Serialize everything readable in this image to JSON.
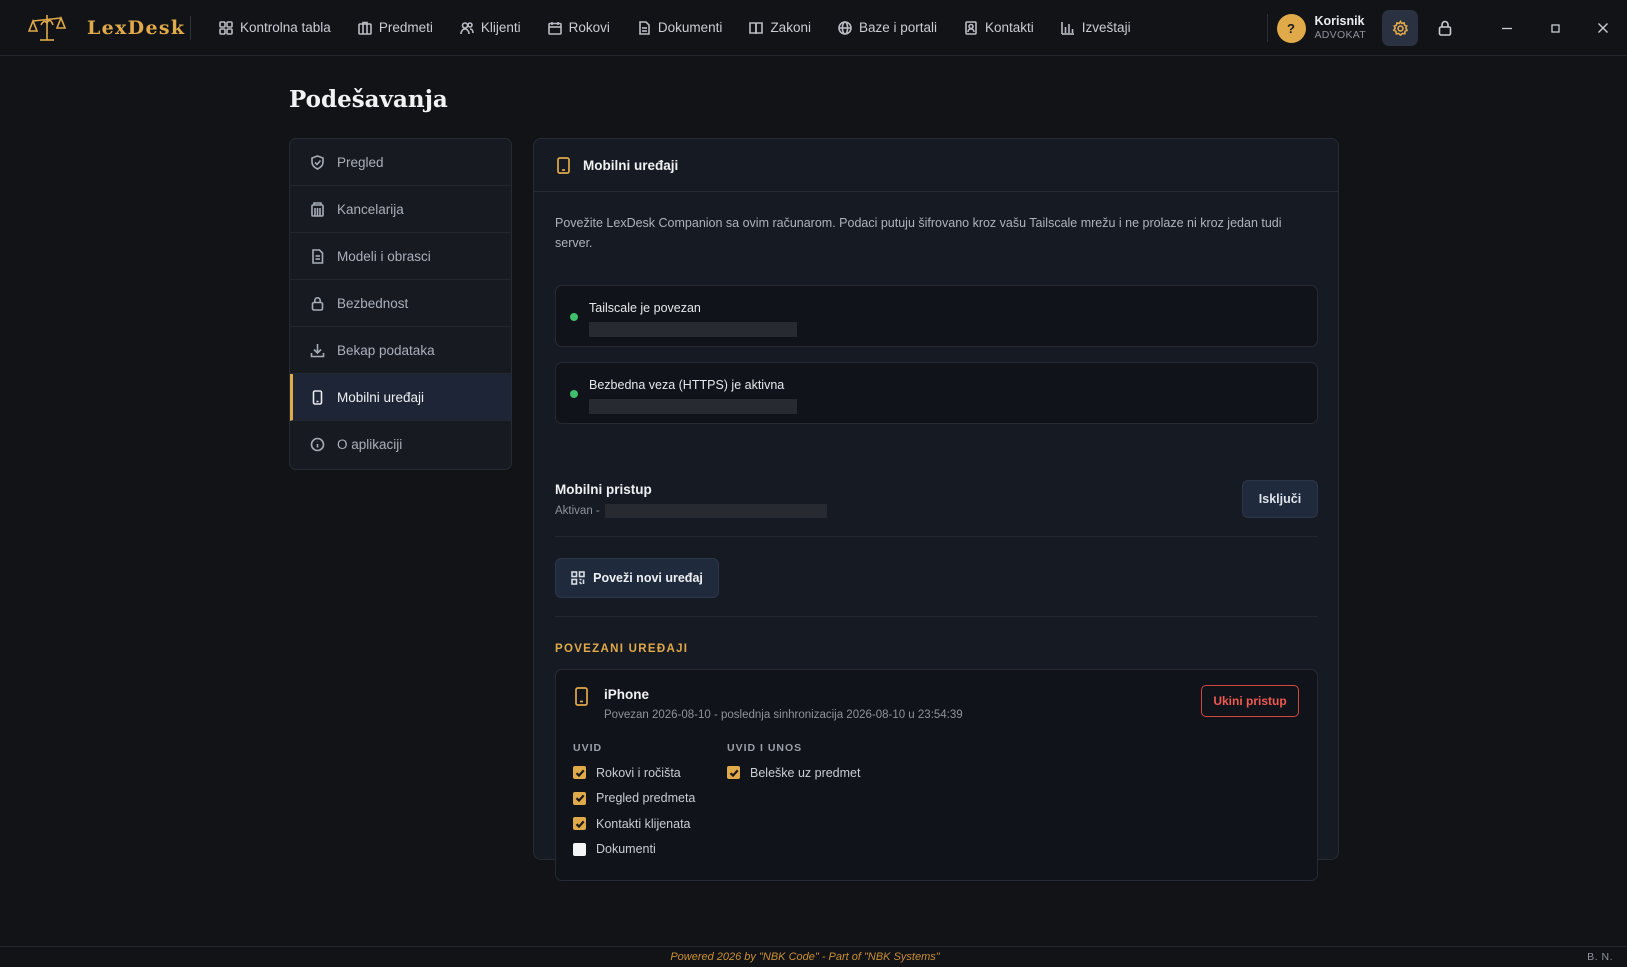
{
  "app": {
    "name": "LexDesk",
    "accent": "#e0a94a"
  },
  "nav": [
    {
      "label": "Kontrolna tabla",
      "icon": "dashboard-icon"
    },
    {
      "label": "Predmeti",
      "icon": "briefcase-icon"
    },
    {
      "label": "Klijenti",
      "icon": "users-icon"
    },
    {
      "label": "Rokovi",
      "icon": "calendar-icon"
    },
    {
      "label": "Dokumenti",
      "icon": "document-icon"
    },
    {
      "label": "Zakoni",
      "icon": "book-icon"
    },
    {
      "label": "Baze i portali",
      "icon": "globe-icon"
    },
    {
      "label": "Kontakti",
      "icon": "contact-icon"
    },
    {
      "label": "Izveštaji",
      "icon": "bar-chart-icon"
    }
  ],
  "user": {
    "avatar_letter": "?",
    "name": "Korisnik",
    "role": "ADVOKAT"
  },
  "page": {
    "title": "Podešavanja"
  },
  "sidebar": {
    "items": [
      {
        "label": "Pregled",
        "icon": "shield-icon"
      },
      {
        "label": "Kancelarija",
        "icon": "building-icon"
      },
      {
        "label": "Modeli i obrasci",
        "icon": "file-icon"
      },
      {
        "label": "Bezbednost",
        "icon": "lock-icon"
      },
      {
        "label": "Bekap podataka",
        "icon": "download-icon"
      },
      {
        "label": "Mobilni uređaji",
        "icon": "phone-icon",
        "active": true
      },
      {
        "label": "O aplikaciji",
        "icon": "info-icon"
      }
    ]
  },
  "card": {
    "title": "Mobilni uređaji",
    "description": "Povežite LexDesk Companion sa ovim računarom. Podaci putuju šifrovano kroz vašu Tailscale mrežu i ne prolaze ni kroz jedan tudi server.",
    "status": [
      {
        "label": "Tailscale je povezan",
        "color": "#3fbf6a"
      },
      {
        "label": "Bezbedna veza (HTTPS) je aktivna",
        "color": "#3fbf6a"
      }
    ],
    "mobile_access": {
      "title": "Mobilni pristup",
      "status_prefix": "Aktivan -",
      "toggle_label": "Isključi"
    },
    "connect_label": "Poveži novi uređaj",
    "devices_section_label": "POVEZANI UREĐAJI",
    "device": {
      "name": "iPhone",
      "meta": "Povezan 2026-08-10 - poslednja sinhronizacija 2026-08-10 u 23:54:39",
      "revoke_label": "Ukini pristup",
      "view": {
        "heading": "UVID",
        "items": [
          {
            "label": "Rokovi i ročišta",
            "checked": true
          },
          {
            "label": "Pregled predmeta",
            "checked": true
          },
          {
            "label": "Kontakti klijenata",
            "checked": true
          },
          {
            "label": "Dokumenti",
            "checked": false
          }
        ]
      },
      "edit": {
        "heading": "UVID I UNOS",
        "items": [
          {
            "label": "Beleške uz predmet",
            "checked": true
          }
        ]
      }
    }
  },
  "footer": {
    "text": "Powered 2026 by \"NBK Code\" - Part of \"NBK Systems\"",
    "initials": "B. N."
  }
}
